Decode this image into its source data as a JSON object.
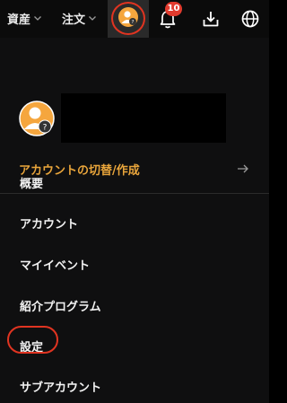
{
  "topbar": {
    "assets_label": "資産",
    "orders_label": "注文",
    "notification_count": "10"
  },
  "menu": {
    "switch_account_label": "アカウントの切替/作成",
    "items": [
      {
        "label": "概要"
      },
      {
        "label": "アカウント"
      },
      {
        "label": "マイイベント"
      },
      {
        "label": "紹介プログラム"
      },
      {
        "label": "設定"
      },
      {
        "label": "サブアカウント"
      }
    ]
  },
  "colors": {
    "accent_orange": "#e9a53b",
    "highlight_red": "#e03421",
    "badge_red": "#e23b2e",
    "avatar_orange": "#f5a63e"
  }
}
